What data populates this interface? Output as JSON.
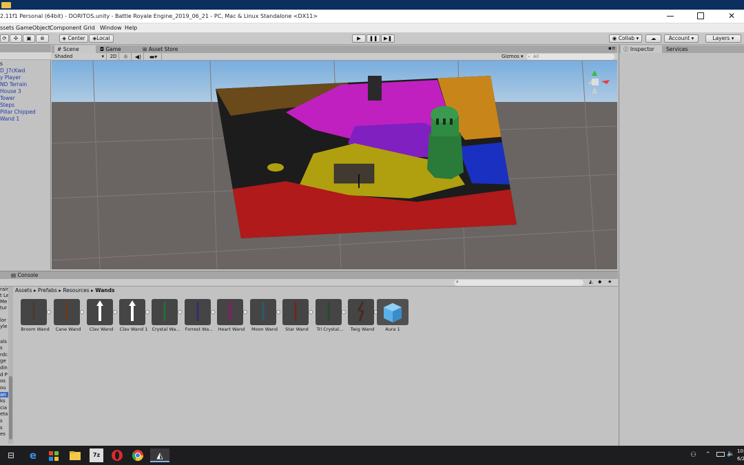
{
  "window": {
    "title": "2.11f1 Personal (64bit) - DORITOS.unity - Battle Royale Engine_2019_06_21 - PC, Mac & Linux Standalone <DX11>"
  },
  "menu": {
    "items": [
      "Assets",
      "GameObject",
      "Component",
      "Grid",
      "Window",
      "Help"
    ],
    "first_visible": "ssets"
  },
  "toolbar": {
    "pivot": "Center",
    "space": "Local",
    "collab": "Collab ▾",
    "account": "Account",
    "layers": "Layers"
  },
  "hierarchy": {
    "items": [
      "D_J7cKwd",
      "y Player",
      "ND Terrain",
      "House 3",
      "Tower",
      "Steps",
      "Pillar Chipped",
      "Wand 1"
    ]
  },
  "scene": {
    "tabs": [
      "Scene",
      "Game",
      "Asset Store"
    ],
    "shading": "Shaded",
    "mode_2d": "2D",
    "gizmos": "Gizmos",
    "search_placeholder": "All"
  },
  "inspector": {
    "tabs": [
      "Inspector",
      "Services"
    ]
  },
  "project": {
    "console_tab": "Console",
    "breadcrumb": [
      "Assets",
      "Prefabs",
      "Resources",
      "Wands"
    ],
    "left_items": [
      "rair",
      "t Le",
      "Me",
      "tur",
      "",
      "lor",
      "yle",
      "",
      "als",
      "s",
      "rdc",
      "ge",
      "din",
      "d P",
      "os",
      "ou",
      "an",
      "ks",
      "cia",
      "eta",
      "s",
      "s",
      "es"
    ],
    "assets": [
      {
        "name": "Broom Wand",
        "color": "#4a3a30"
      },
      {
        "name": "Cane Wand",
        "color": "#6a3a1a"
      },
      {
        "name": "Clav Wand",
        "color": "#ffffff"
      },
      {
        "name": "Clav Wand 1",
        "color": "#ffffff"
      },
      {
        "name": "Crystal Wa...",
        "color": "#2a6a3a"
      },
      {
        "name": "Forrest Wa...",
        "color": "#3a2a6a"
      },
      {
        "name": "Heart Wand",
        "color": "#8a1a6a"
      },
      {
        "name": "Moon Wand",
        "color": "#2a5a6a"
      },
      {
        "name": "Star Wand",
        "color": "#6a2a1a"
      },
      {
        "name": "Tri Crystal...",
        "color": "#2a4a2a"
      },
      {
        "name": "Twig Wand",
        "color": "#4a2a20"
      },
      {
        "name": "Aura 1",
        "color": "#5ab0e8"
      }
    ]
  },
  "taskbar": {
    "clock_time": "10:",
    "clock_date": "6/2"
  },
  "colors": {
    "terrain_red": "#b01a1a",
    "terrain_black": "#1c1c1c",
    "terrain_magenta": "#c020c0",
    "terrain_purple": "#8020c0",
    "terrain_yellow": "#b0a010",
    "terrain_blue": "#1a30c0",
    "terrain_orange": "#c8861a",
    "terrain_brown": "#6a4a1a",
    "tower_green": "#2a7a3a"
  }
}
